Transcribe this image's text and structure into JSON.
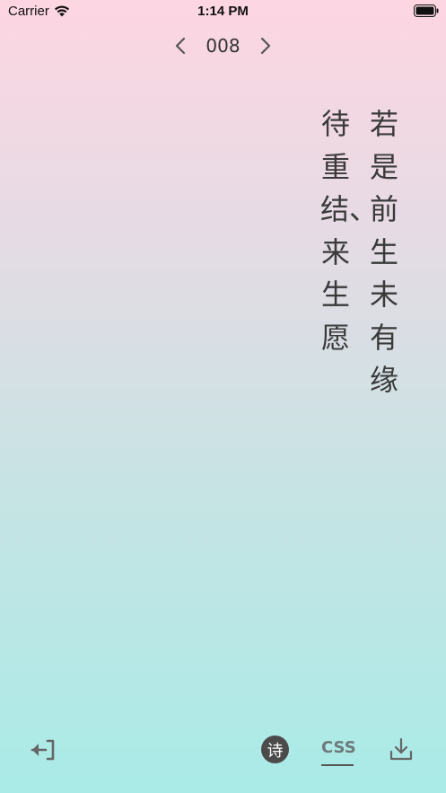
{
  "status_bar": {
    "carrier": "Carrier",
    "time": "1:14 PM"
  },
  "pager": {
    "page_number": "008"
  },
  "poem": {
    "lines": [
      "若是前生未有缘",
      "待重结、来生愿"
    ]
  },
  "toolbar": {
    "poem_label": "诗",
    "css_label": "CSS"
  },
  "colors": {
    "gradient_top": "#fdd6e2",
    "gradient_bottom": "#a9ebe7",
    "text": "#3a3a3a",
    "icon": "#666666"
  },
  "icons": [
    "wifi-icon",
    "battery-icon",
    "chevron-left-icon",
    "chevron-right-icon",
    "exit-icon",
    "download-icon"
  ]
}
